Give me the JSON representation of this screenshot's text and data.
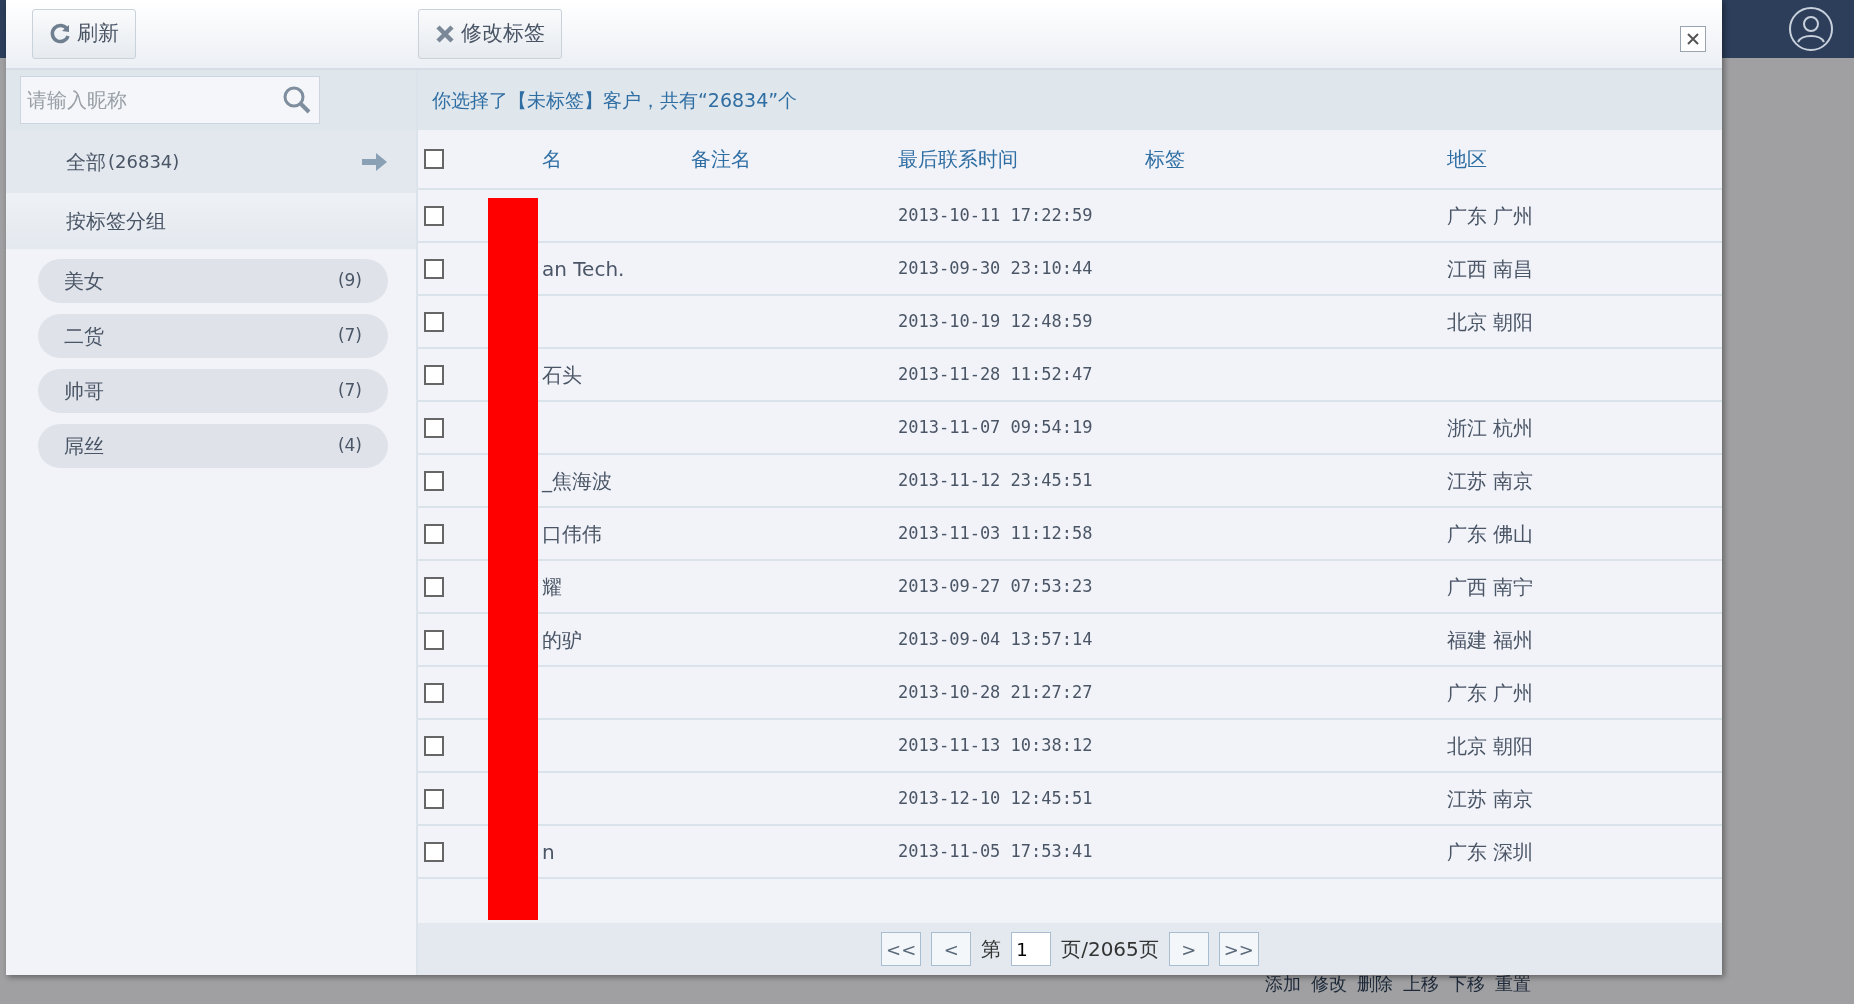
{
  "toolbar": {
    "buttons": [
      {
        "kind": "refresh",
        "label": "刷新"
      },
      {
        "kind": "edit_tags",
        "label": "修改标签"
      }
    ]
  },
  "search": {
    "placeholder": "请输入昵称"
  },
  "sidebar": {
    "all": {
      "label": "全部",
      "count": "(26834)",
      "selected": true
    },
    "group_title": "按标签分组",
    "tags": [
      {
        "label": "美女",
        "count": "(9)"
      },
      {
        "label": "二货",
        "count": "(7)"
      },
      {
        "label": "帅哥",
        "count": "(7)"
      },
      {
        "label": "屌丝",
        "count": "(4)"
      }
    ]
  },
  "info": "你选择了【未标签】客户，共有“26834”个",
  "table": {
    "select_all_checked": false,
    "columns": [
      "名",
      "备注名",
      "最后联系时间",
      "标签",
      "地区"
    ],
    "rows": [
      {
        "checked": false,
        "name": "",
        "remark": "",
        "time": "2013-10-11 17:22:59",
        "tag": "",
        "region": "广东 广州"
      },
      {
        "checked": false,
        "name": "an Tech.",
        "remark": "",
        "time": "2013-09-30 23:10:44",
        "tag": "",
        "region": "江西 南昌"
      },
      {
        "checked": false,
        "name": "",
        "remark": "",
        "time": "2013-10-19 12:48:59",
        "tag": "",
        "region": "北京 朝阳"
      },
      {
        "checked": false,
        "name": "石头",
        "remark": "",
        "time": "2013-11-28 11:52:47",
        "tag": "",
        "region": ""
      },
      {
        "checked": false,
        "name": "",
        "remark": "",
        "time": "2013-11-07 09:54:19",
        "tag": "",
        "region": "浙江 杭州"
      },
      {
        "checked": false,
        "name": "_焦海波",
        "remark": "",
        "time": "2013-11-12 23:45:51",
        "tag": "",
        "region": "江苏 南京"
      },
      {
        "checked": false,
        "name": "口伟伟",
        "remark": "",
        "time": "2013-11-03 11:12:58",
        "tag": "",
        "region": "广东 佛山"
      },
      {
        "checked": false,
        "name": "耀",
        "remark": "",
        "time": "2013-09-27 07:53:23",
        "tag": "",
        "region": "广西 南宁"
      },
      {
        "checked": false,
        "name": "的驴",
        "remark": "",
        "time": "2013-09-04 13:57:14",
        "tag": "",
        "region": "福建 福州"
      },
      {
        "checked": false,
        "name": "",
        "remark": "",
        "time": "2013-10-28 21:27:27",
        "tag": "",
        "region": "广东 广州"
      },
      {
        "checked": false,
        "name": "",
        "remark": "",
        "time": "2013-11-13 10:38:12",
        "tag": "",
        "region": "北京 朝阳"
      },
      {
        "checked": false,
        "name": "",
        "remark": "",
        "time": "2013-12-10 12:45:51",
        "tag": "",
        "region": "江苏 南京"
      },
      {
        "checked": false,
        "name": "n",
        "remark": "",
        "time": "2013-11-05 17:53:41",
        "tag": "",
        "region": "广东 深圳"
      }
    ]
  },
  "pager": {
    "first": "<<",
    "prev": "<",
    "before": "第",
    "page": "1",
    "after": "页/2065页",
    "next": ">",
    "last": ">>"
  },
  "background_toolbar": [
    "添加",
    "修改",
    "删除",
    "上移",
    "下移",
    "重置"
  ]
}
